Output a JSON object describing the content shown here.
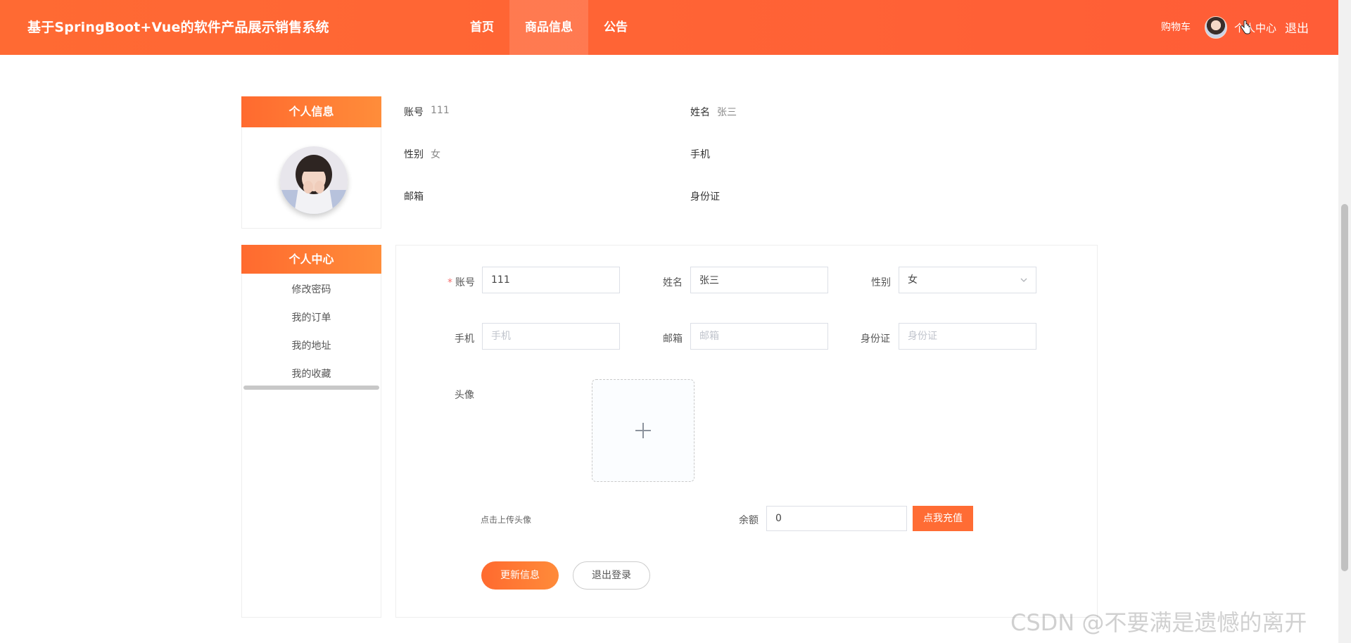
{
  "header": {
    "title": "基于SpringBoot+Vue的软件产品展示销售系统",
    "nav": [
      "首页",
      "商品信息",
      "公告"
    ],
    "cart": "购物车",
    "center": "个人中心",
    "logout": "退出"
  },
  "profile_panel": {
    "title": "个人信息"
  },
  "menu_panel": {
    "title": "个人中心",
    "items": [
      "修改密码",
      "我的订单",
      "我的地址",
      "我的收藏"
    ]
  },
  "info": {
    "account_label": "账号",
    "account_value": "111",
    "name_label": "姓名",
    "name_value": "张三",
    "gender_label": "性别",
    "gender_value": "女",
    "phone_label": "手机",
    "email_label": "邮箱",
    "idcard_label": "身份证"
  },
  "form": {
    "account_label": "账号",
    "account_value": "111",
    "name_label": "姓名",
    "name_value": "张三",
    "gender_label": "性别",
    "gender_value": "女",
    "phone_label": "手机",
    "phone_placeholder": "手机",
    "email_label": "邮箱",
    "email_placeholder": "邮箱",
    "idcard_label": "身份证",
    "idcard_placeholder": "身份证",
    "avatar_label": "头像",
    "upload_hint": "点击上传头像",
    "balance_label": "余额",
    "balance_value": "0",
    "recharge_button": "点我充值",
    "update_button": "更新信息",
    "logout_button": "退出登录"
  },
  "watermark": "CSDN @不要满是遗憾的离开",
  "colors": {
    "primary": "#ff5d37",
    "accent": "#ff8d3a"
  }
}
